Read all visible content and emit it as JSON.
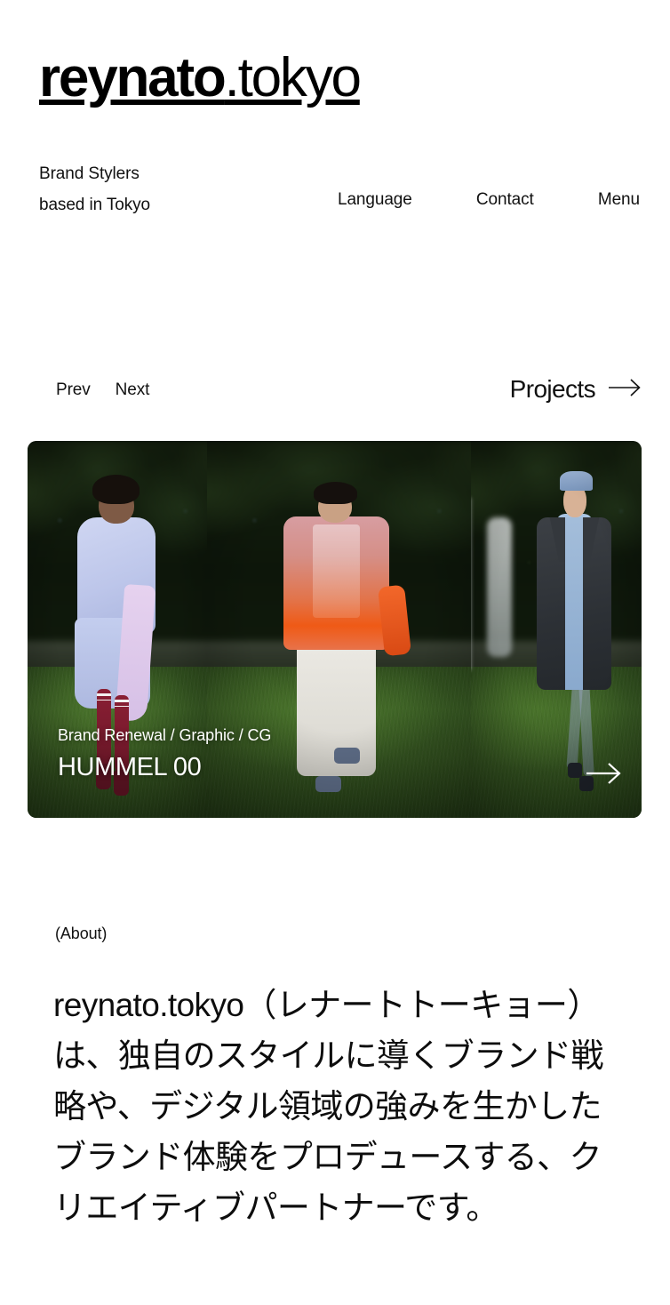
{
  "site": {
    "logo_strong": "reynato",
    "logo_light": ".tokyo",
    "tagline_line1": "Brand Stylers",
    "tagline_line2": "based in Tokyo"
  },
  "nav": {
    "items": [
      {
        "label": "Language",
        "name": "nav-language"
      },
      {
        "label": "Contact",
        "name": "nav-contact"
      },
      {
        "label": "Menu",
        "name": "nav-menu"
      }
    ]
  },
  "carousel": {
    "prev_label": "Prev",
    "next_label": "Next",
    "projects_label": "Projects",
    "projects_arrow": "arrow-right-icon",
    "slide_next_arrow": "slide-next-arrow-icon",
    "caption": {
      "tags": "Brand Renewal / Graphic / CG",
      "title": "HUMMEL 00"
    },
    "slides": [
      {
        "alt": "runway-model-lavender-sweater"
      },
      {
        "alt": "runway-model-orange-ombre-shirt"
      },
      {
        "alt": "runway-model-dark-coat-blue-dress"
      }
    ]
  },
  "about": {
    "label": "(About)",
    "body": "reynato.tokyo（レナートトーキョー）は、独自のスタイルに導くブランド戦略や、デジタル領域の強みを生かしたブランド体験をプロデュースする、クリエイティブパートナーです。"
  },
  "colors": {
    "background": "#ffffff",
    "text": "#111111",
    "caption_text": "#ffffff"
  }
}
